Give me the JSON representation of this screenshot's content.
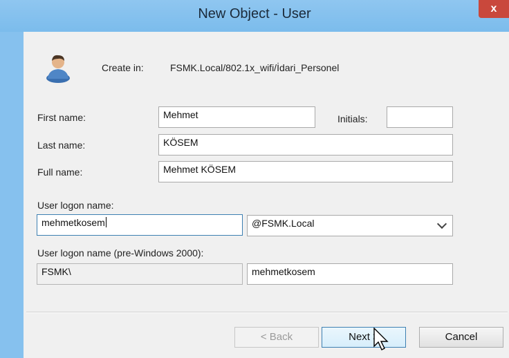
{
  "window": {
    "title": "New Object - User",
    "close_glyph": "x"
  },
  "header": {
    "create_in_label": "Create in:",
    "create_in_path": "FSMK.Local/802.1x_wifi/İdari_Personel",
    "icon": "user-icon"
  },
  "form": {
    "first_name_label": "First name:",
    "first_name_value": "Mehmet",
    "initials_label": "Initials:",
    "initials_value": "",
    "last_name_label": "Last name:",
    "last_name_value": "KÖSEM",
    "full_name_label": "Full name:",
    "full_name_value": "Mehmet KÖSEM",
    "logon_name_label": "User logon name:",
    "logon_name_value": "mehmetkosem",
    "domain_selected": "@FSMK.Local",
    "pre2000_label": "User logon name (pre-Windows 2000):",
    "pre2000_domain": "FSMK\\",
    "pre2000_name": "mehmetkosem"
  },
  "buttons": {
    "back_label": "< Back",
    "next_label": "Next >",
    "cancel_label": "Cancel"
  },
  "colors": {
    "titlebar": "#7bbcec",
    "close_button": "#c9483c",
    "focus_border": "#3c7fb1"
  }
}
